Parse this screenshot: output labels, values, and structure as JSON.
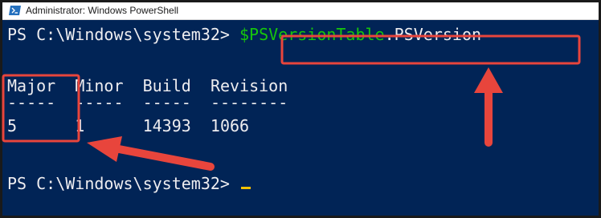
{
  "window": {
    "title": "Administrator: Windows PowerShell"
  },
  "console": {
    "prompt_1": "PS C:\\Windows\\system32> ",
    "command_var": "$PSVersionTable",
    "command_prop": ".PSVersion",
    "headers": [
      "Major",
      "Minor",
      "Build",
      "Revision"
    ],
    "separators": [
      "-----",
      "-----",
      "-----",
      "--------"
    ],
    "values": [
      "5",
      "1",
      "14393",
      "1066"
    ],
    "prompt_2": "PS C:\\Windows\\system32> "
  },
  "annotations": {
    "highlight_color": "#e8453c",
    "shapes": [
      "command-highlight-box",
      "major-highlight-box",
      "arrow-up",
      "arrow-left"
    ]
  },
  "colors": {
    "console_bg": "#012456",
    "console_fg": "#eeedf0",
    "variable": "#16c60c",
    "cursor": "#f2c200"
  }
}
